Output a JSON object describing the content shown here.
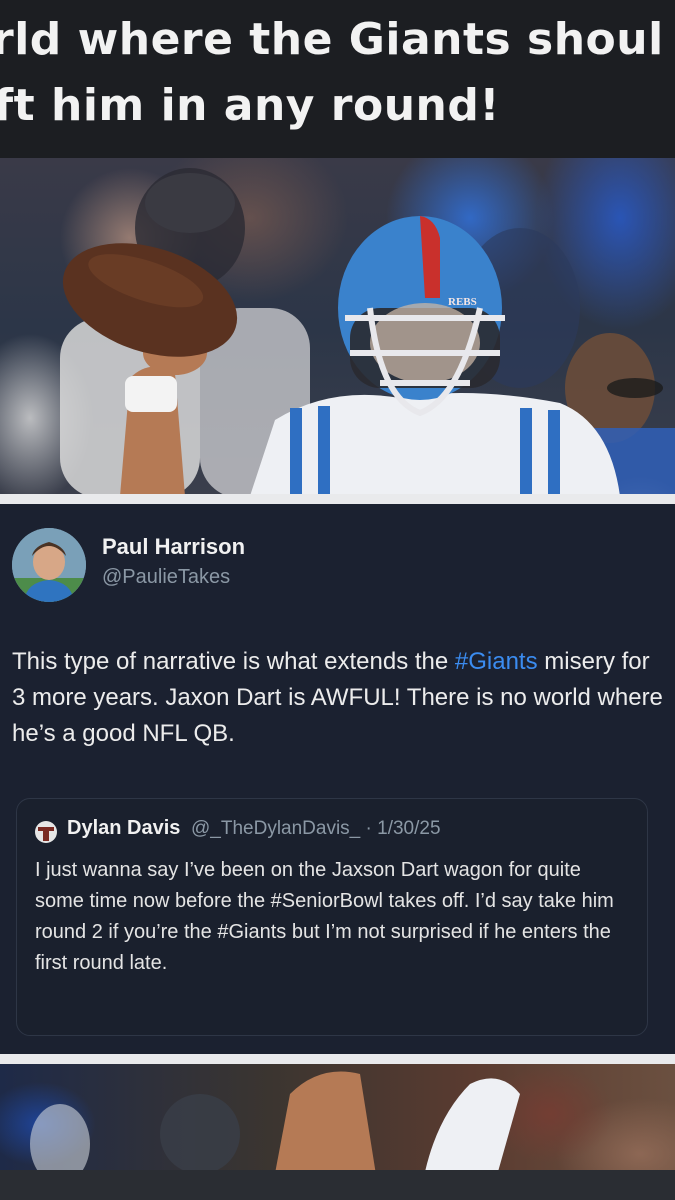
{
  "caption": {
    "line1": "rld where the Giants shoul",
    "line2": "ft him in any round!"
  },
  "hero": {
    "helmet_text": "REBS"
  },
  "tweet": {
    "author_name": "Paul Harrison",
    "author_handle": "@PaulieTakes",
    "body_part1": "This type of narrative is what extends the ",
    "hashtag": "#Giants",
    "body_part2": " misery for 3 more years. Jaxon Dart is AWFUL! There is no world where he’s a good NFL QB.",
    "quote": {
      "author_name": "Dylan Davis",
      "handle_date": "@_TheDylanDavis_ · 1/30/25",
      "body": "I just wanna say I’ve been on the Jaxson Dart wagon for quite some time now before the #SeniorBowl takes off.  I’d say take him round 2 if you’re the #Giants but I’m not surprised if he enters the first round late."
    }
  },
  "colors": {
    "background": "#15171c",
    "card": "#1b2130",
    "hashtag": "#3b8cf0",
    "handle": "#8b98a5"
  }
}
